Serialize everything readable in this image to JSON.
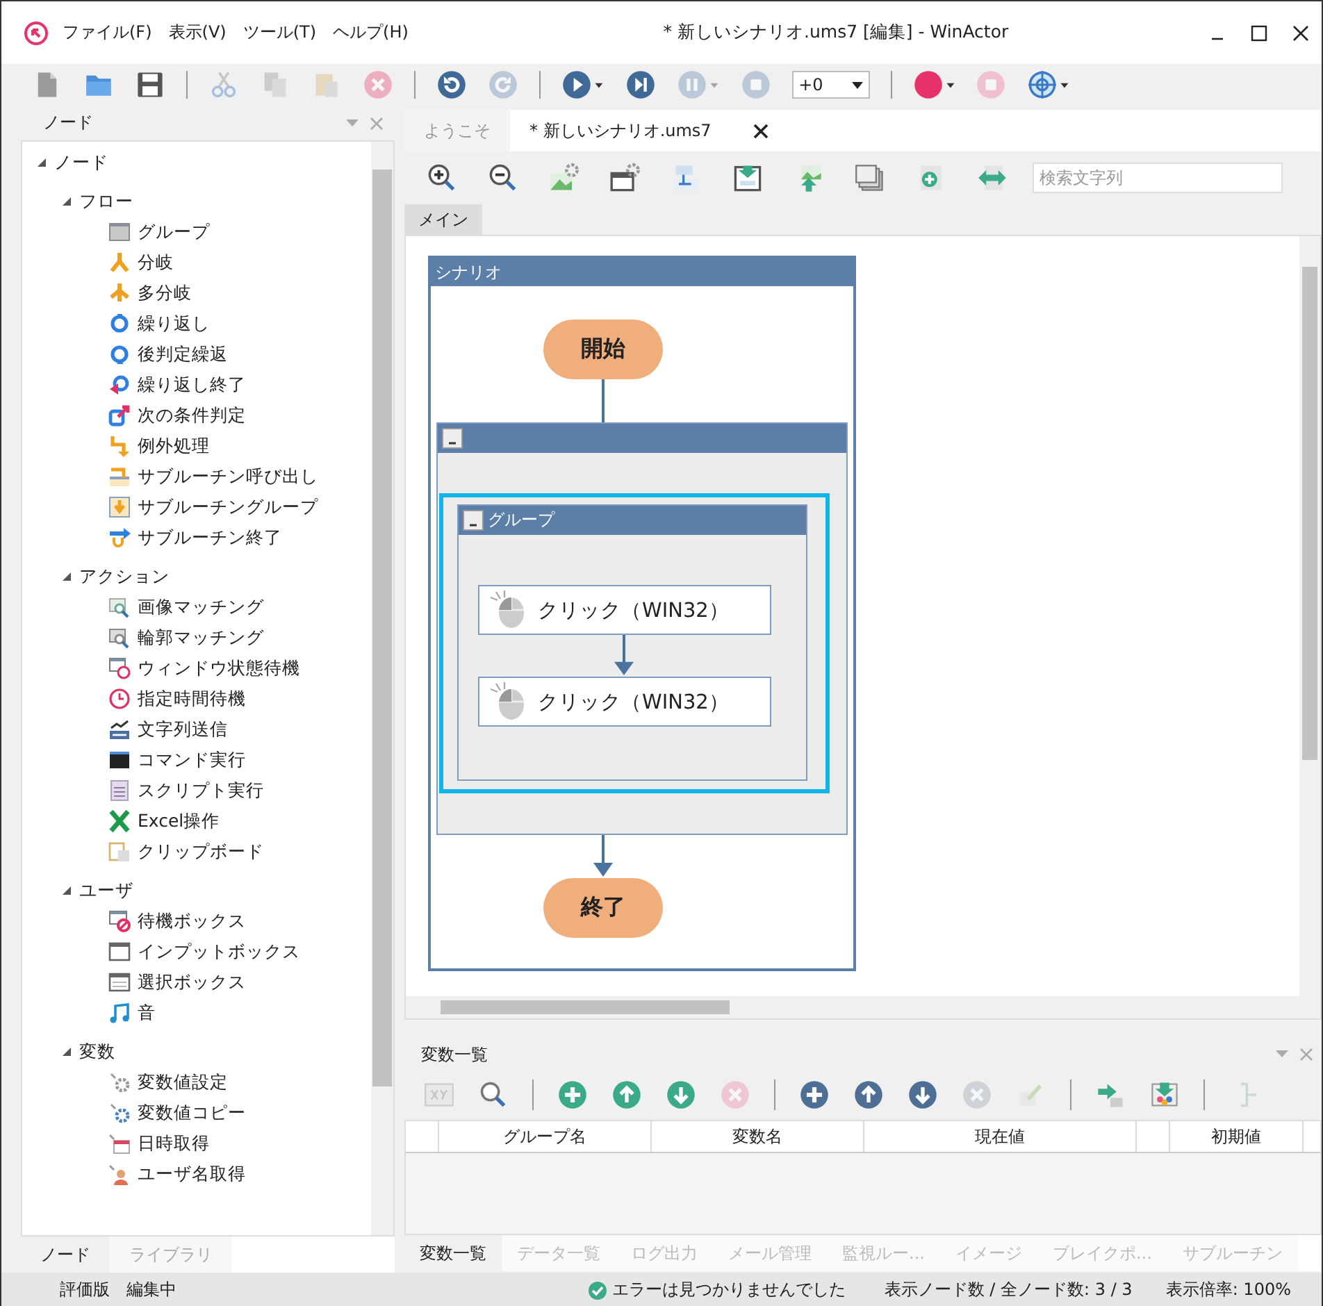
{
  "window": {
    "title": "* 新しいシナリオ.ums7 [編集] - WinActor"
  },
  "menu": [
    "ファイル(F)",
    "表示(V)",
    "ツール(T)",
    "ヘルプ(H)"
  ],
  "toolbar": [
    {
      "kind": "button",
      "disabled": false
    },
    {
      "kind": "button",
      "disabled": false
    },
    {
      "kind": "button",
      "disabled": false
    },
    {
      "kind": "separator"
    },
    {
      "kind": "button",
      "disabled": true
    },
    {
      "kind": "button",
      "disabled": true
    },
    {
      "kind": "button",
      "disabled": true
    },
    {
      "kind": "button",
      "disabled": true
    },
    {
      "kind": "separator"
    },
    {
      "kind": "button",
      "disabled": false
    },
    {
      "kind": "button",
      "disabled": true
    },
    {
      "kind": "separator"
    },
    {
      "kind": "button",
      "disabled": false
    },
    {
      "kind": "button",
      "disabled": false
    },
    {
      "kind": "button",
      "disabled": true
    },
    {
      "kind": "button",
      "disabled": true
    },
    {
      "kind": "dropdown",
      "value": "+0"
    },
    {
      "kind": "separator"
    },
    {
      "kind": "button",
      "disabled": false
    },
    {
      "kind": "button",
      "disabled": true
    },
    {
      "kind": "button",
      "disabled": false
    }
  ],
  "node_panel": {
    "title": "ノード",
    "tree": [
      {
        "label": "ノード",
        "expanded": true,
        "children": [
          {
            "label": "フロー",
            "expanded": true,
            "children": [
              {
                "label": "グループ"
              },
              {
                "label": "分岐"
              },
              {
                "label": "多分岐"
              },
              {
                "label": "繰り返し"
              },
              {
                "label": "後判定繰返"
              },
              {
                "label": "繰り返し終了"
              },
              {
                "label": "次の条件判定"
              },
              {
                "label": "例外処理"
              },
              {
                "label": "サブルーチン呼び出し"
              },
              {
                "label": "サブルーチングループ"
              },
              {
                "label": "サブルーチン終了"
              }
            ]
          },
          {
            "label": "アクション",
            "expanded": true,
            "children": [
              {
                "label": "画像マッチング"
              },
              {
                "label": "輪郭マッチング"
              },
              {
                "label": "ウィンドウ状態待機"
              },
              {
                "label": "指定時間待機"
              },
              {
                "label": "文字列送信"
              },
              {
                "label": "コマンド実行"
              },
              {
                "label": "スクリプト実行"
              },
              {
                "label": "Excel操作"
              },
              {
                "label": "クリップボード"
              }
            ]
          },
          {
            "label": "ユーザ",
            "expanded": true,
            "children": [
              {
                "label": "待機ボックス"
              },
              {
                "label": "インプットボックス"
              },
              {
                "label": "選択ボックス"
              },
              {
                "label": "音"
              }
            ]
          },
          {
            "label": "変数",
            "expanded": true,
            "children": [
              {
                "label": "変数値設定"
              },
              {
                "label": "変数値コピー"
              },
              {
                "label": "日時取得"
              },
              {
                "label": "ユーザ名取得"
              }
            ]
          }
        ]
      }
    ],
    "tabs": [
      {
        "label": "ノード",
        "selected": true
      },
      {
        "label": "ライブラリ",
        "selected": false
      }
    ]
  },
  "editor": {
    "tabs": [
      {
        "label": "ようこそ",
        "selected": false
      },
      {
        "label": "* 新しいシナリオ.ums7",
        "selected": true
      }
    ],
    "search": {
      "placeholder": "検索文字列"
    },
    "sheet_tabs": [
      {
        "label": "メイン",
        "selected": true
      }
    ],
    "scenario": {
      "title": "シナリオ",
      "body": [
        {
          "kind": "start",
          "label": "開始"
        },
        {
          "kind": "group",
          "selected": false,
          "children": [
            {
              "kind": "group",
              "title": "グループ",
              "selected": true,
              "children": [
                {
                  "kind": "action",
                  "label": "クリック（WIN32）"
                },
                {
                  "kind": "action",
                  "label": "クリック（WIN32）"
                }
              ]
            }
          ]
        },
        {
          "kind": "end",
          "label": "終了"
        }
      ]
    }
  },
  "variable_panel": {
    "title": "変数一覧",
    "toolbar": [
      {
        "kind": "button",
        "disabled": true
      },
      {
        "kind": "button",
        "disabled": false
      },
      {
        "kind": "separator"
      },
      {
        "kind": "button",
        "disabled": false
      },
      {
        "kind": "button",
        "disabled": false
      },
      {
        "kind": "button",
        "disabled": false
      },
      {
        "kind": "button",
        "disabled": true
      },
      {
        "kind": "separator"
      },
      {
        "kind": "button",
        "disabled": false
      },
      {
        "kind": "button",
        "disabled": false
      },
      {
        "kind": "button",
        "disabled": false
      },
      {
        "kind": "button",
        "disabled": true
      },
      {
        "kind": "button",
        "disabled": true
      },
      {
        "kind": "separator"
      },
      {
        "kind": "button",
        "disabled": false
      },
      {
        "kind": "button",
        "disabled": false
      },
      {
        "kind": "separator"
      },
      {
        "kind": "button",
        "disabled": true
      }
    ],
    "columns": [
      {
        "kind": "blank"
      },
      {
        "kind": "text",
        "label": "グループ名"
      },
      {
        "kind": "text",
        "label": "変数名"
      },
      {
        "kind": "text",
        "label": "現在値"
      },
      {
        "kind": "blank"
      },
      {
        "kind": "text",
        "label": "初期値"
      },
      {
        "kind": "blank"
      }
    ],
    "tabs": [
      {
        "label": "変数一覧",
        "selected": true
      },
      {
        "label": "データ一覧",
        "selected": false
      },
      {
        "label": "ログ出力",
        "selected": false
      },
      {
        "label": "メール管理",
        "selected": false
      },
      {
        "label": "監視ルー...",
        "selected": false
      },
      {
        "label": "イメージ",
        "selected": false
      },
      {
        "label": "ブレイクポ...",
        "selected": false
      },
      {
        "label": "サブルーチン",
        "selected": false
      }
    ]
  },
  "status_bar": {
    "left": [
      "評価版",
      "編集中"
    ],
    "check": "エラーは見つかりませんでした",
    "node_count": "表示ノード数 / 全ノード数: 3 / 3",
    "zoom": "表示倍率: 100%"
  }
}
